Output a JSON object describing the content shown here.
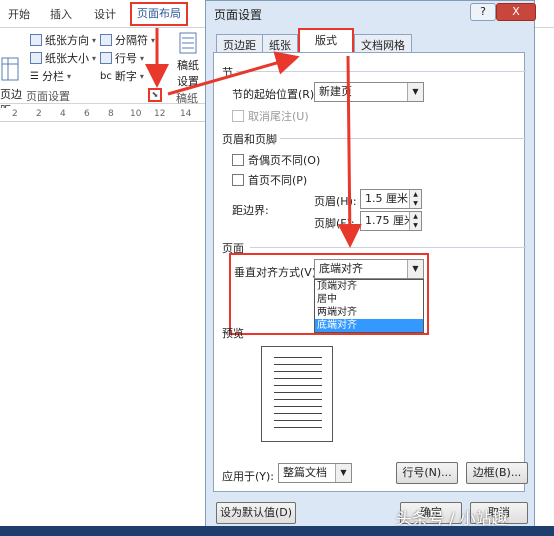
{
  "ribbon": {
    "tabs": [
      "开始",
      "插入",
      "设计",
      "页面布局"
    ],
    "items": {
      "margins": "页边距",
      "orientation": "纸张方向",
      "size": "纸张大小",
      "columns": "分栏",
      "breaks": "分隔符",
      "line_numbers": "行号",
      "hyphenation": "断字",
      "manuscript_line1": "稿纸",
      "manuscript_line2": "设置",
      "manuscript_group": "稿纸"
    },
    "group_label": "页面设置",
    "ruler_marks": [
      "2",
      "2",
      "4",
      "6",
      "8",
      "10",
      "12",
      "14"
    ]
  },
  "dialog": {
    "title": "页面设置",
    "help": "?",
    "close": "X",
    "tabs": [
      "页边距",
      "纸张",
      "版式",
      "文档网格"
    ],
    "active_tab": "版式",
    "section": {
      "heading": "节",
      "start_label": "节的起始位置(R):",
      "start_value": "新建页",
      "suppress_endnotes": "取消尾注(U)"
    },
    "header_footer": {
      "heading": "页眉和页脚",
      "odd_even": "奇偶页不同(O)",
      "first_page": "首页不同(P)",
      "from_edge": "距边界:",
      "header_label": "页眉(H):",
      "header_value": "1.5 厘米",
      "footer_label": "页脚(F):",
      "footer_value": "1.75 厘米"
    },
    "page": {
      "heading": "页面",
      "valign_label": "垂直对齐方式(V):",
      "valign_value": "底端对齐",
      "valign_options": [
        "顶端对齐",
        "居中",
        "两端对齐",
        "底端对齐"
      ],
      "valign_selected": "底端对齐"
    },
    "preview_label": "预览",
    "apply_label": "应用于(Y):",
    "apply_value": "整篇文档",
    "line_numbers_button": "行号(N)...",
    "borders_button": "边框(B)...",
    "set_default_button": "设为默认值(D)",
    "ok_button": "确定",
    "cancel_button": "取消"
  },
  "watermark": "头条号 / 小站趣",
  "colors": {
    "annotation": "#e8372b",
    "dialog_bg": "#dbe7f5",
    "selection": "#3399ff",
    "taskbar": "#1e3f6e"
  }
}
